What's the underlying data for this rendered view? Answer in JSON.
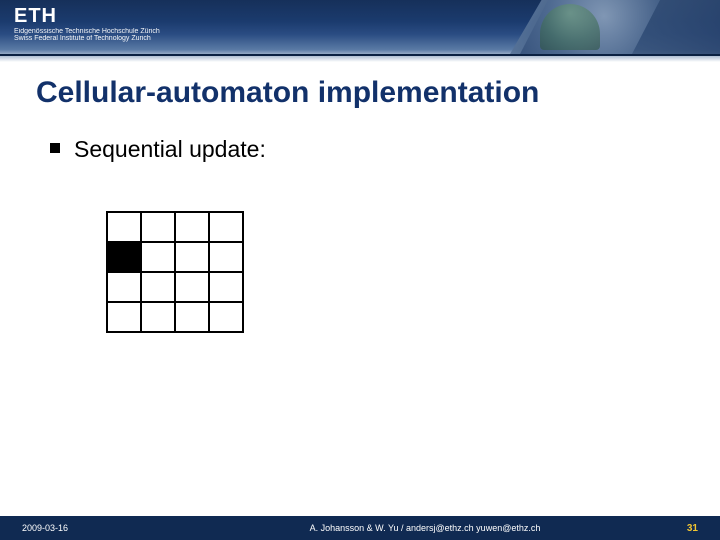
{
  "header": {
    "logo_text": "ETH",
    "logo_sub1": "Eidgenössische Technische Hochschule Zürich",
    "logo_sub2": "Swiss Federal Institute of Technology Zurich"
  },
  "title": "Cellular-automaton implementation",
  "bullet": {
    "text": "Sequential update:"
  },
  "grid": {
    "rows": 4,
    "cols": 4,
    "filled": [
      [
        1,
        0
      ]
    ]
  },
  "footer": {
    "date": "2009-03-16",
    "author": "A. Johansson & W. Yu / andersj@ethz.ch yuwen@ethz.ch",
    "page": "31"
  }
}
